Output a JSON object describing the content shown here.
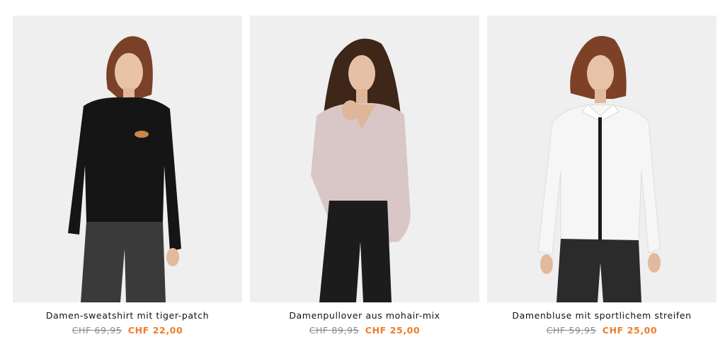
{
  "products": [
    {
      "image_label": "Damen-sweatshirt mit tiger-patch",
      "title": "Damen-sweatshirt mit tiger-patch",
      "old_price": "CHF 69,95",
      "new_price": "CHF 22,00",
      "top_color": "#151515",
      "pants_color": "#3a3a3a",
      "hair_color": "#7a4128"
    },
    {
      "image_label": "Damenpullover aus mohair-mix",
      "title": "Damenpullover aus mohair-mix",
      "old_price": "CHF 89,95",
      "new_price": "CHF 25,00",
      "top_color": "#d9c6c6",
      "pants_color": "#1c1c1c",
      "hair_color": "#3e2619"
    },
    {
      "image_label": "Damenbluse mit sportlichem streifen",
      "title": "Damenbluse mit sportlichem streifen",
      "old_price": "CHF 59,95",
      "new_price": "CHF 25,00",
      "top_color": "#f6f6f6",
      "pants_color": "#2b2b2b",
      "hair_color": "#7d4128"
    }
  ],
  "colors": {
    "sale_price": "#f07c2a",
    "old_price": "#8a8a8a",
    "image_bg": "#efefef"
  }
}
